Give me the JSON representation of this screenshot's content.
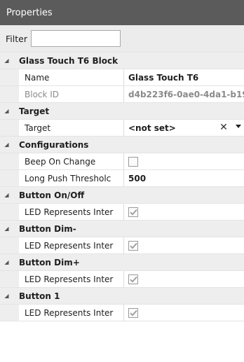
{
  "panel": {
    "title": "Properties"
  },
  "filter": {
    "label": "Filter",
    "value": ""
  },
  "colors": {
    "titlebar": "#5b5b5b",
    "category_bg": "#eeeeee",
    "checkbox_check": "#9a9a9a"
  },
  "categories": [
    {
      "label": "Glass Touch T6 Block",
      "expanded": true,
      "properties": [
        {
          "name": "Name",
          "value": "Glass Touch T6",
          "type": "text",
          "readonly": false
        },
        {
          "name": "Block ID",
          "value": "d4b223f6-0ae0-4da1-b19",
          "type": "text",
          "readonly": true
        }
      ]
    },
    {
      "label": "Target",
      "expanded": true,
      "properties": [
        {
          "name": "Target",
          "value": "<not set>",
          "type": "dropdown",
          "readonly": false
        }
      ]
    },
    {
      "label": "Configurations",
      "expanded": true,
      "properties": [
        {
          "name": "Beep On Change",
          "checked": false,
          "type": "checkbox",
          "readonly": false
        },
        {
          "name": "Long Push Thresholc",
          "value": "500",
          "type": "text",
          "readonly": false
        }
      ]
    },
    {
      "label": "Button On/Off",
      "expanded": true,
      "properties": [
        {
          "name": "LED Represents Inter",
          "checked": true,
          "type": "checkbox",
          "readonly": false
        }
      ]
    },
    {
      "label": "Button Dim-",
      "expanded": true,
      "properties": [
        {
          "name": "LED Represents Inter",
          "checked": true,
          "type": "checkbox",
          "readonly": false
        }
      ]
    },
    {
      "label": "Button Dim+",
      "expanded": true,
      "properties": [
        {
          "name": "LED Represents Inter",
          "checked": true,
          "type": "checkbox",
          "readonly": false
        }
      ]
    },
    {
      "label": "Button 1",
      "expanded": true,
      "properties": [
        {
          "name": "LED Represents Inter",
          "checked": true,
          "type": "checkbox",
          "readonly": false
        }
      ]
    }
  ]
}
